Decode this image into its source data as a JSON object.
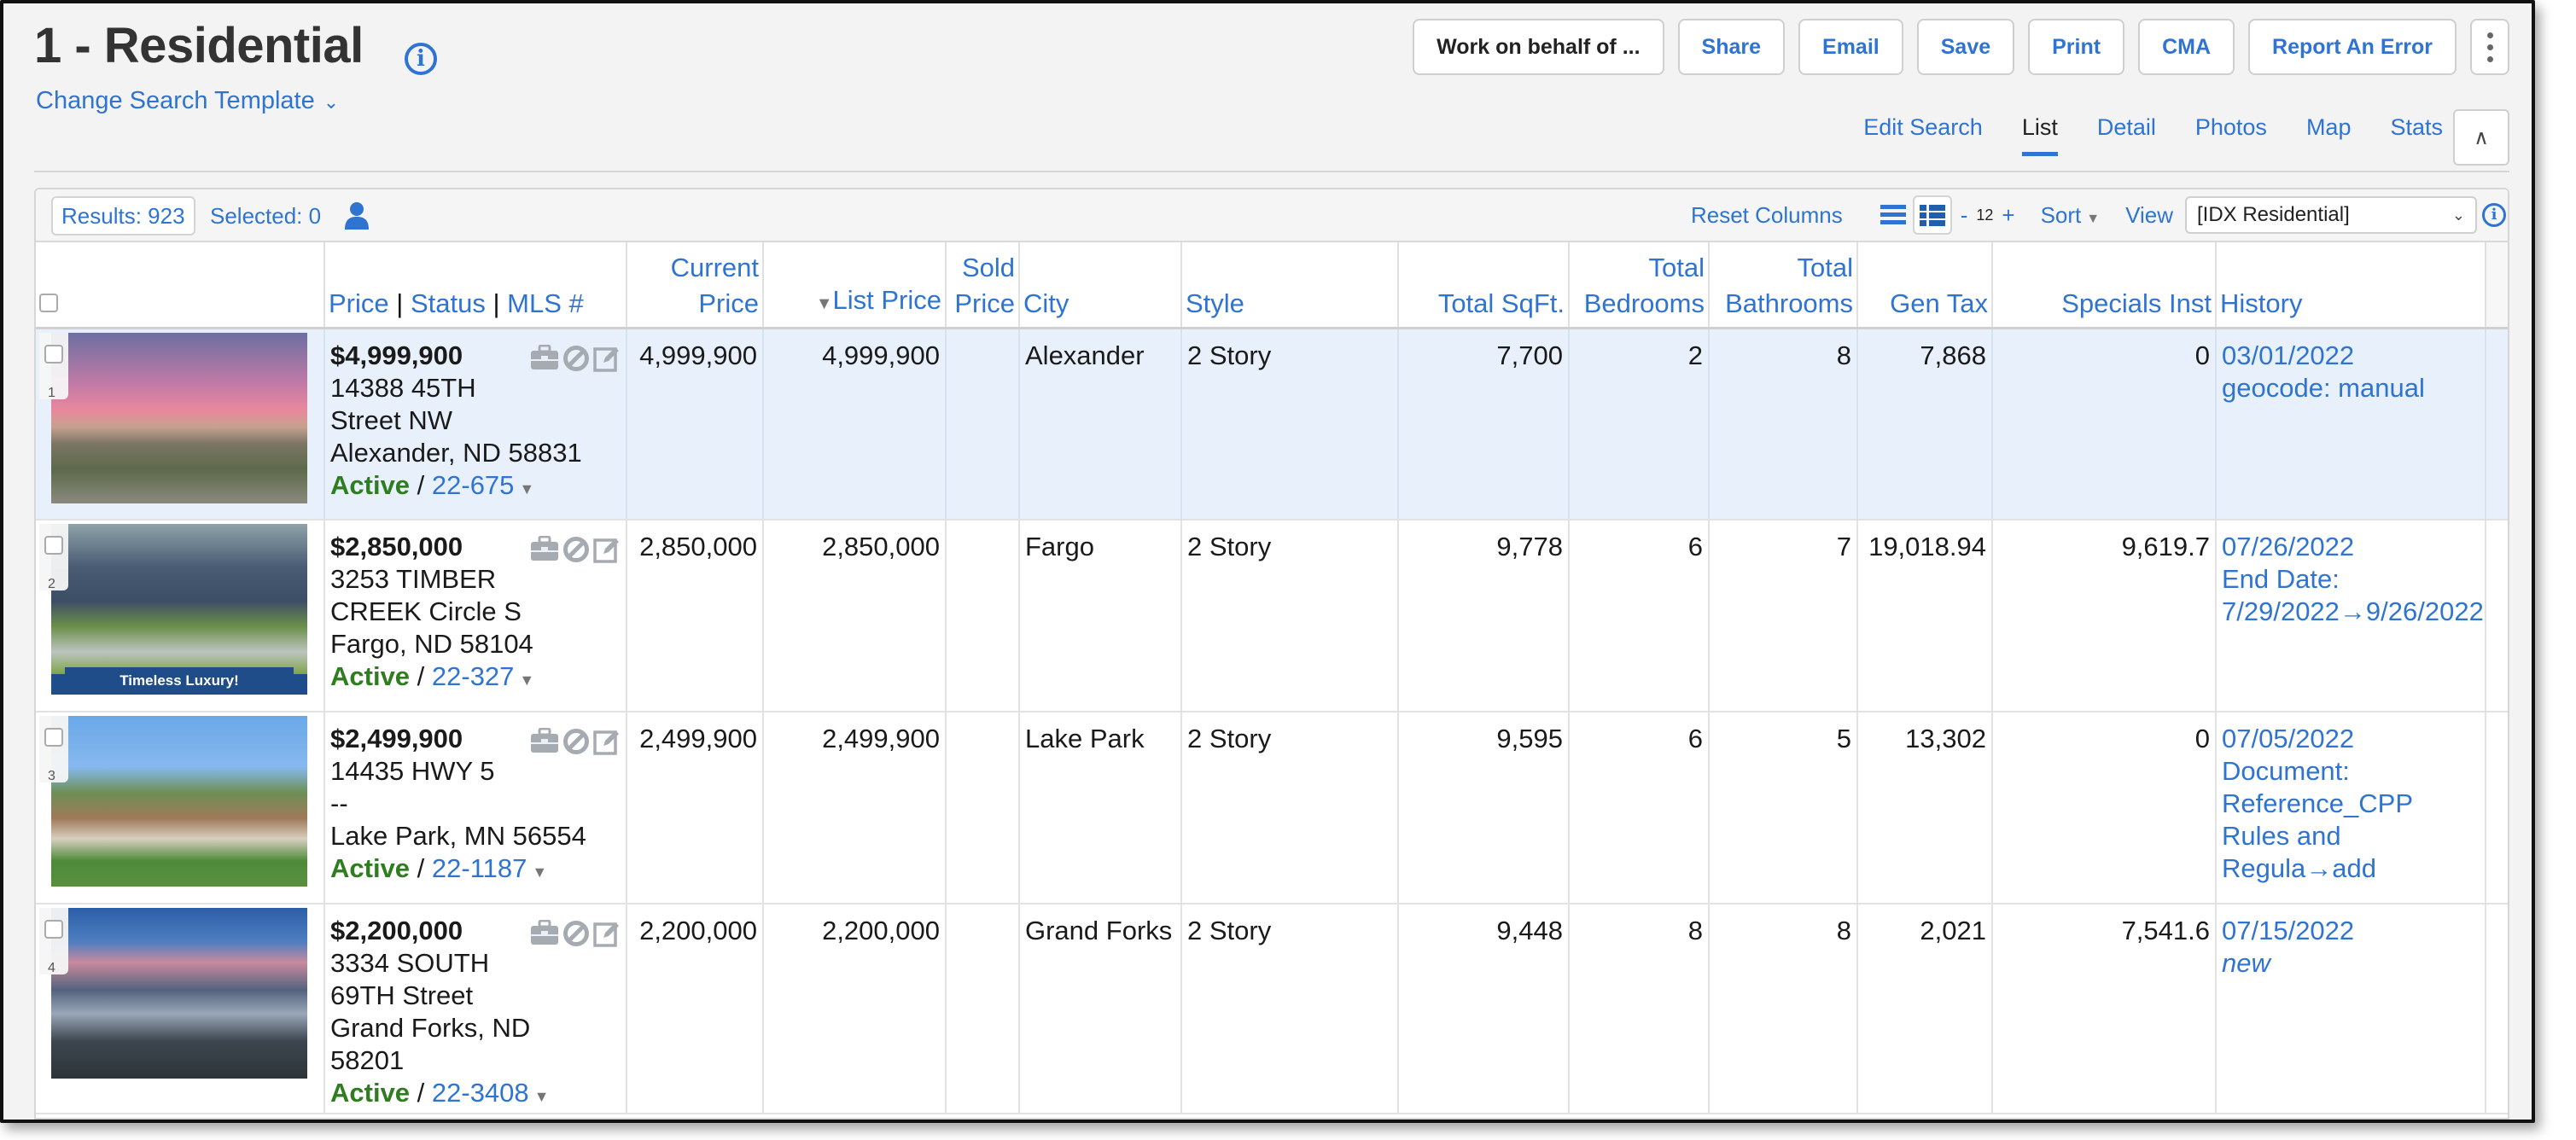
{
  "header": {
    "title": "1 - Residential",
    "change_template": "Change Search Template",
    "buttons": {
      "work_on_behalf": "Work on behalf of ...",
      "share": "Share",
      "email": "Email",
      "save": "Save",
      "print": "Print",
      "cma": "CMA",
      "report_error": "Report An Error"
    },
    "tabs": [
      {
        "label": "Edit Search",
        "active": false
      },
      {
        "label": "List",
        "active": true
      },
      {
        "label": "Detail",
        "active": false
      },
      {
        "label": "Photos",
        "active": false
      },
      {
        "label": "Map",
        "active": false
      },
      {
        "label": "Stats",
        "active": false
      }
    ]
  },
  "toolbar": {
    "results": "Results: 923",
    "selected": "Selected: 0",
    "reset_columns": "Reset Columns",
    "minus": "-",
    "count": "12",
    "plus": "+",
    "sort": "Sort",
    "view_label": "View",
    "view_value": "[IDX Residential]"
  },
  "columns": {
    "price": "Price",
    "sep": "|",
    "status": "Status",
    "mls": "MLS #",
    "current_price_1": "Current",
    "current_price_2": "Price",
    "list_price": "List Price",
    "sold_price_1": "Sold",
    "sold_price_2": "Price",
    "city": "City",
    "style": "Style",
    "total_sqft": "Total SqFt.",
    "bedrooms_1": "Total",
    "bedrooms_2": "Bedrooms",
    "bathrooms_1": "Total",
    "bathrooms_2": "Bathrooms",
    "gen_tax": "Gen Tax",
    "specials_inst": "Specials Inst",
    "history": "History"
  },
  "rows": [
    {
      "num": "1",
      "banner": "",
      "price": "$4,999,900",
      "address1": "14388 45TH",
      "address2": "Street NW",
      "address3": "Alexander, ND 58831",
      "address4": "",
      "status": "Active",
      "slash": " / ",
      "mls": "22-675",
      "current_price": "4,999,900",
      "list_price": "4,999,900",
      "sold_price": "",
      "city": "Alexander",
      "style": "2 Story",
      "total_sqft": "7,700",
      "bedrooms": "2",
      "bathrooms": "8",
      "gen_tax": "7,868",
      "specials_inst": "0",
      "history_date": "03/01/2022",
      "history_note": "geocode: manual",
      "highlighted": true
    },
    {
      "num": "2",
      "banner": "Timeless Luxury!",
      "price": "$2,850,000",
      "address1": "3253 TIMBER",
      "address2": "CREEK Circle S",
      "address3": "Fargo, ND 58104",
      "address4": "",
      "status": "Active",
      "slash": " / ",
      "mls": "22-327",
      "current_price": "2,850,000",
      "list_price": "2,850,000",
      "sold_price": "",
      "city": "Fargo",
      "style": "2 Story",
      "total_sqft": "9,778",
      "bedrooms": "6",
      "bathrooms": "7",
      "gen_tax": "19,018.94",
      "specials_inst": "9,619.7",
      "history_date": "07/26/2022",
      "history_note": "End Date: 7/29/2022→9/26/2022",
      "highlighted": false
    },
    {
      "num": "3",
      "banner": "",
      "price": "$2,499,900",
      "address1": "14435 HWY 5",
      "address2": "--",
      "address3": "Lake Park, MN 56554",
      "address4": "",
      "status": "Active",
      "slash": " / ",
      "mls": "22-1187",
      "current_price": "2,499,900",
      "list_price": "2,499,900",
      "sold_price": "",
      "city": "Lake Park",
      "style": "2 Story",
      "total_sqft": "9,595",
      "bedrooms": "6",
      "bathrooms": "5",
      "gen_tax": "13,302",
      "specials_inst": "0",
      "history_date": "07/05/2022",
      "history_note": "Document: Reference_CPP Rules and Regula→add",
      "highlighted": false
    },
    {
      "num": "4",
      "banner": "",
      "price": "$2,200,000",
      "address1": "3334 SOUTH",
      "address2": "69TH Street",
      "address3": "Grand Forks, ND",
      "address4": "58201",
      "status": "Active",
      "slash": " / ",
      "mls": "22-3408",
      "current_price": "2,200,000",
      "list_price": "2,200,000",
      "sold_price": "",
      "city": "Grand Forks",
      "style": "2 Story",
      "total_sqft": "9,448",
      "bedrooms": "8",
      "bathrooms": "8",
      "gen_tax": "2,021",
      "specials_inst": "7,541.6",
      "history_date": "07/15/2022",
      "history_note": "new",
      "history_note_italic": true,
      "highlighted": false
    }
  ],
  "icons": {
    "row_actions": [
      "briefcase-icon",
      "prohibited-icon",
      "edit-icon"
    ],
    "toolbar": [
      "person-icon",
      "list-view-icon",
      "detail-list-view-icon",
      "info-icon"
    ]
  },
  "colors": {
    "accent": "#2f74d0",
    "active_status": "#2e7d1f",
    "highlight_row": "#e8f1fb"
  }
}
